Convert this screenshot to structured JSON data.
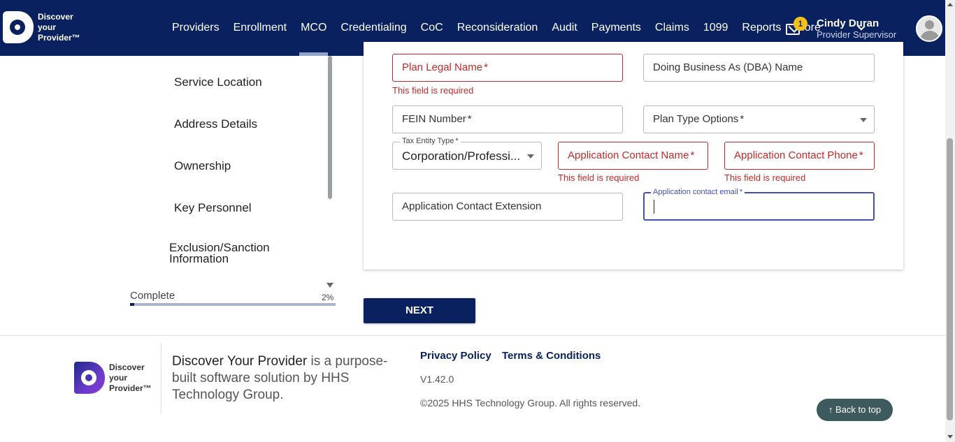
{
  "brand": {
    "line1": "Discover",
    "line2": "your",
    "line3": "Provider™"
  },
  "nav": [
    "Providers",
    "Enrollment",
    "MCO",
    "Credentialing",
    "CoC",
    "Reconsideration",
    "Audit",
    "Payments",
    "Claims",
    "1099",
    "Reports",
    "More"
  ],
  "nav_active": "MCO",
  "notifications": {
    "count": "1"
  },
  "user": {
    "name": "Cindy Duran",
    "role": "Provider Supervisor"
  },
  "sidebar": {
    "items": [
      "Service Location",
      "Address Details",
      "Ownership",
      "Key Personnel",
      "Exclusion/Sanction Information"
    ],
    "complete_label": "Complete",
    "complete_pct": "2%",
    "progress_fraction": 0.02
  },
  "form": {
    "plan_legal_name": {
      "label": "Plan Legal Name",
      "req": "*",
      "error": "This field is required"
    },
    "dba_name": {
      "label": "Doing Business As (DBA) Name"
    },
    "fein": {
      "label": "FEIN Number",
      "req": "*"
    },
    "plan_type": {
      "label": "Plan Type Options",
      "req": "*"
    },
    "tax_entity": {
      "label": "Tax Entity Type",
      "req": "*",
      "value": "Corporation/Professi..."
    },
    "contact_name": {
      "label": "Application Contact Name",
      "req": "*",
      "error": "This field is required"
    },
    "contact_phone": {
      "label": "Application Contact Phone",
      "req": "*",
      "error": "This field is required"
    },
    "contact_ext": {
      "label": "Application Contact Extension"
    },
    "contact_email": {
      "label": "Application contact email",
      "req": "*",
      "value": ""
    }
  },
  "next_label": "NEXT",
  "footer": {
    "brand": {
      "line1": "Discover",
      "line2": "your",
      "line3": "Provider™"
    },
    "desc_bold": "Discover Your Provider",
    "desc_rest": " is a purpose-built software solution by HHS Technology Group.",
    "privacy": "Privacy Policy",
    "terms": "Terms & Conditions",
    "version": "V1.42.0",
    "copyright": "©2025 HHS Technology Group. All rights reserved.",
    "back_to_top": "Back to top"
  },
  "colors": {
    "header_bg": "#0a2160",
    "error": "#c62828",
    "focus": "#3f51b5",
    "badge": "#f2c21b"
  }
}
